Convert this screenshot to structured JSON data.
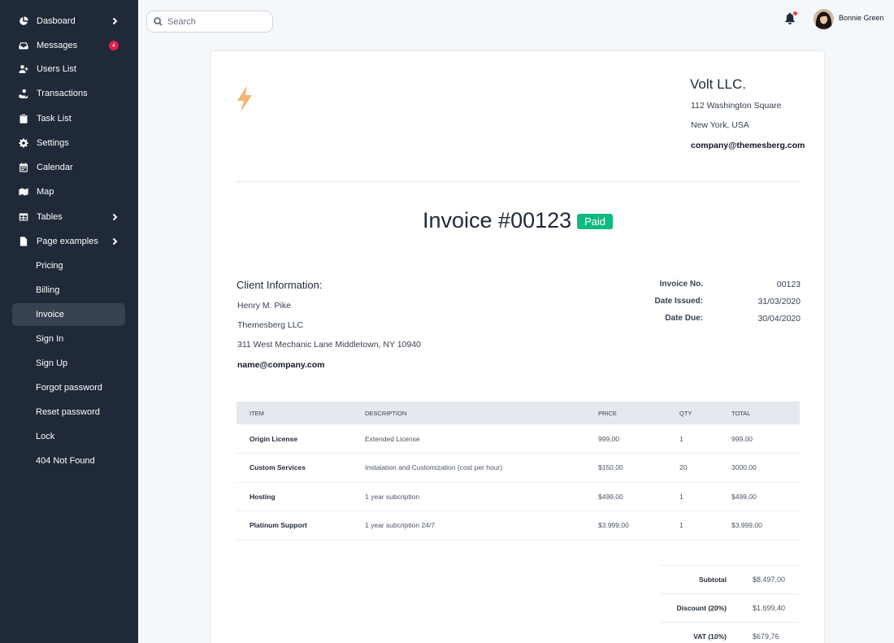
{
  "sidebar": {
    "items": [
      {
        "label": "Dasboard",
        "icon": "pie-chart-icon",
        "chevron": true
      },
      {
        "label": "Messages",
        "icon": "inbox-icon",
        "badge": "4"
      },
      {
        "label": "Users List",
        "icon": "user-add-icon"
      },
      {
        "label": "Transactions",
        "icon": "hand-coin-icon"
      },
      {
        "label": "Task List",
        "icon": "clipboard-icon"
      },
      {
        "label": "Settings",
        "icon": "gear-icon"
      },
      {
        "label": "Calendar",
        "icon": "calendar-icon"
      },
      {
        "label": "Map",
        "icon": "map-icon"
      },
      {
        "label": "Tables",
        "icon": "table-icon",
        "chevron": true
      },
      {
        "label": "Page examples",
        "icon": "document-icon",
        "chevron": true
      }
    ],
    "sub_items": [
      "Pricing",
      "Billing",
      "Invoice",
      "Sign In",
      "Sign Up",
      "Forgot password",
      "Reset password",
      "Lock",
      "404 Not Found"
    ],
    "active_sub_item": "Invoice"
  },
  "topbar": {
    "search_placeholder": "Search",
    "user_name": "Bonnie Green",
    "notification_dot_color": "#ef4444"
  },
  "invoice": {
    "company": {
      "name": "Volt LLC.",
      "address_line1": "112 Washington Square",
      "address_line2": "New York, USA",
      "email": "company@themesberg.com"
    },
    "title": "Invoice #00123",
    "status": "Paid",
    "status_color": "#10b981",
    "client": {
      "heading": "Client Information:",
      "name": "Henry M. Pike",
      "company": "Themesberg LLC",
      "address": "311 West Mechanic Lane Middletown, NY 10940",
      "email": "name@company.com"
    },
    "meta": [
      {
        "label": "Invoice No.",
        "value": "00123"
      },
      {
        "label": "Date Issued:",
        "value": "31/03/2020"
      },
      {
        "label": "Date Due:",
        "value": "30/04/2020"
      }
    ],
    "table": {
      "headers": [
        "Item",
        "Description",
        "Price",
        "Qty",
        "Total"
      ],
      "rows": [
        [
          "Origin License",
          "Extended License",
          "999,00",
          "1",
          "999,00"
        ],
        [
          "Custom Services",
          "Instalation and Customization (cost per hour)",
          "$150,00",
          "20",
          "3000,00"
        ],
        [
          "Hosting",
          "1 year subcription",
          "$499,00",
          "1",
          "$499,00"
        ],
        [
          "Platinum Support",
          "1 year subcription 24/7",
          "$3.999,00",
          "1",
          "$3.999,00"
        ]
      ]
    },
    "totals": [
      {
        "label": "Subtotal",
        "value": "$8.497,00"
      },
      {
        "label": "Discount (20%)",
        "value": "$1.699,40"
      },
      {
        "label": "VAT (10%)",
        "value": "$679,76"
      }
    ]
  }
}
